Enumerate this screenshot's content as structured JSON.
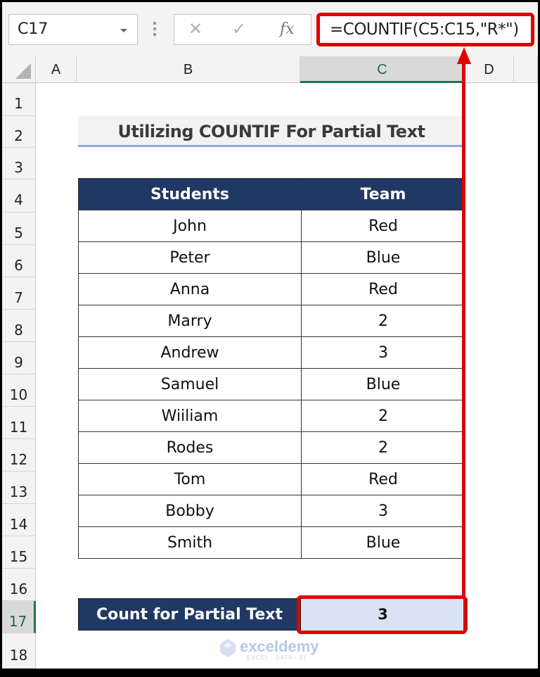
{
  "name_box": {
    "value": "C17"
  },
  "formula_bar": {
    "cancel_icon": "✕",
    "enter_icon": "✓",
    "fx_label": "fx",
    "formula": "=COUNTIF(C5:C15,\"R*\")"
  },
  "columns": [
    "A",
    "B",
    "C",
    "D"
  ],
  "selected_column": "C",
  "rows": [
    "1",
    "2",
    "3",
    "4",
    "5",
    "6",
    "7",
    "8",
    "9",
    "10",
    "11",
    "12",
    "13",
    "14",
    "15",
    "16",
    "17",
    "18"
  ],
  "selected_row": "17",
  "sheet": {
    "title": "Utilizing COUNTIF For Partial Text",
    "table": {
      "headers": [
        "Students",
        "Team"
      ],
      "rows": [
        [
          "John",
          "Red"
        ],
        [
          "Peter",
          "Blue"
        ],
        [
          "Anna",
          "Red"
        ],
        [
          "Marry",
          "2"
        ],
        [
          "Andrew",
          "3"
        ],
        [
          "Samuel",
          "Blue"
        ],
        [
          "Wiiliam",
          "2"
        ],
        [
          "Rodes",
          "2"
        ],
        [
          "Tom",
          "Red"
        ],
        [
          "Bobby",
          "3"
        ],
        [
          "Smith",
          "Blue"
        ]
      ]
    },
    "count_label": "Count for Partial Text",
    "count_value": "3"
  },
  "watermark": {
    "name": "exceldemy",
    "tagline": "EXCEL · DATA · BI"
  },
  "colors": {
    "header_fill": "#203864",
    "highlight": "#e00000",
    "result_fill": "#dae3f3",
    "selection": "#217346"
  }
}
